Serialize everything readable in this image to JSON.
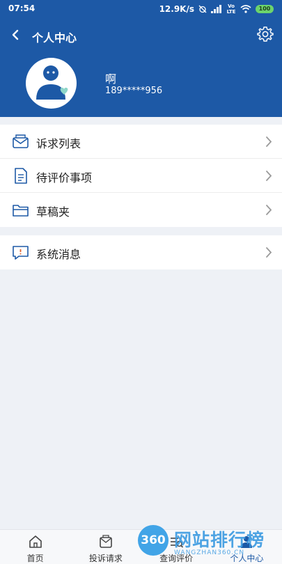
{
  "status_bar": {
    "time": "07:54",
    "speed": "12.9K/s",
    "network": "Vo LTE",
    "battery": "100"
  },
  "nav": {
    "title": "个人中心",
    "back_icon": "chevron-left-icon",
    "settings_icon": "gear-icon"
  },
  "profile": {
    "name": "啊",
    "phone": "189*****956"
  },
  "menu_group_1": [
    {
      "label": "诉求列表",
      "icon": "envelope-icon"
    },
    {
      "label": "待评价事项",
      "icon": "document-icon"
    },
    {
      "label": "草稿夹",
      "icon": "folder-icon"
    }
  ],
  "menu_group_2": [
    {
      "label": "系统消息",
      "icon": "message-icon"
    }
  ],
  "tabbar": [
    {
      "label": "首页",
      "icon": "home-icon"
    },
    {
      "label": "投诉请求",
      "icon": "complaint-icon"
    },
    {
      "label": "查询评价",
      "icon": "query-icon"
    },
    {
      "label": "个人中心",
      "icon": "person-icon"
    }
  ],
  "watermark": {
    "badge": "360",
    "title": "网站排行榜",
    "subtitle": "WANGZHAN360.CN"
  },
  "colors": {
    "header": "#1d59a6",
    "background": "#eef1f6",
    "accent": "#1d59a6"
  }
}
